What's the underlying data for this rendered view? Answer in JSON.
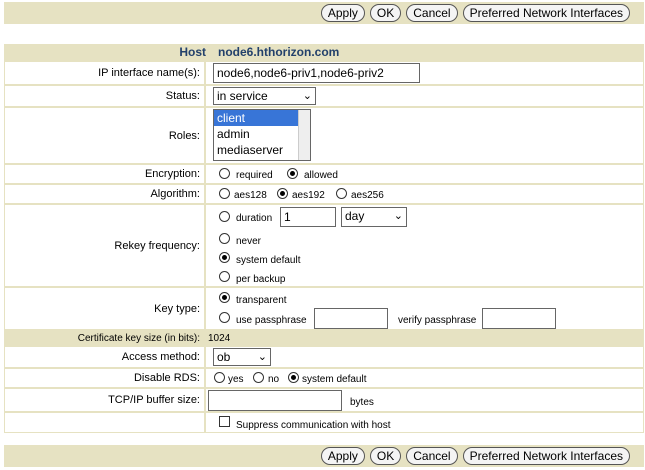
{
  "toolbar": {
    "apply": "Apply",
    "ok": "OK",
    "cancel": "Cancel",
    "preferred": "Preferred Network Interfaces"
  },
  "host": {
    "label": "Host",
    "value": "node6.hthorizon.com"
  },
  "ip_interfaces": {
    "label": "IP interface name(s):",
    "value": "node6,node6-priv1,node6-priv2"
  },
  "status": {
    "label": "Status:",
    "value": "in service"
  },
  "roles": {
    "label": "Roles:",
    "options": [
      "client",
      "admin",
      "mediaserver"
    ],
    "selected": "client"
  },
  "encryption": {
    "label": "Encryption:",
    "options": [
      "required",
      "allowed"
    ],
    "selected": "allowed"
  },
  "algorithm": {
    "label": "Algorithm:",
    "options": [
      "aes128",
      "aes192",
      "aes256"
    ],
    "selected": "aes192"
  },
  "rekey": {
    "label": "Rekey frequency:",
    "duration_label": "duration",
    "duration_value": "1",
    "duration_unit": "day",
    "never": "never",
    "system_default": "system default",
    "per_backup": "per backup",
    "selected": "system default"
  },
  "key_type": {
    "label": "Key type:",
    "transparent": "transparent",
    "use_passphrase": "use passphrase",
    "verify_passphrase": "verify passphrase",
    "selected": "transparent"
  },
  "cert_key_size": {
    "label": "Certificate key size (in bits):",
    "value": "1024"
  },
  "access_method": {
    "label": "Access method:",
    "value": "ob"
  },
  "disable_rds": {
    "label": "Disable RDS:",
    "options": [
      "yes",
      "no",
      "system default"
    ],
    "selected": "system default"
  },
  "buffer": {
    "label": "TCP/IP buffer size:",
    "unit": "bytes"
  },
  "suppress": {
    "label": "Suppress communication with host",
    "checked": false
  }
}
